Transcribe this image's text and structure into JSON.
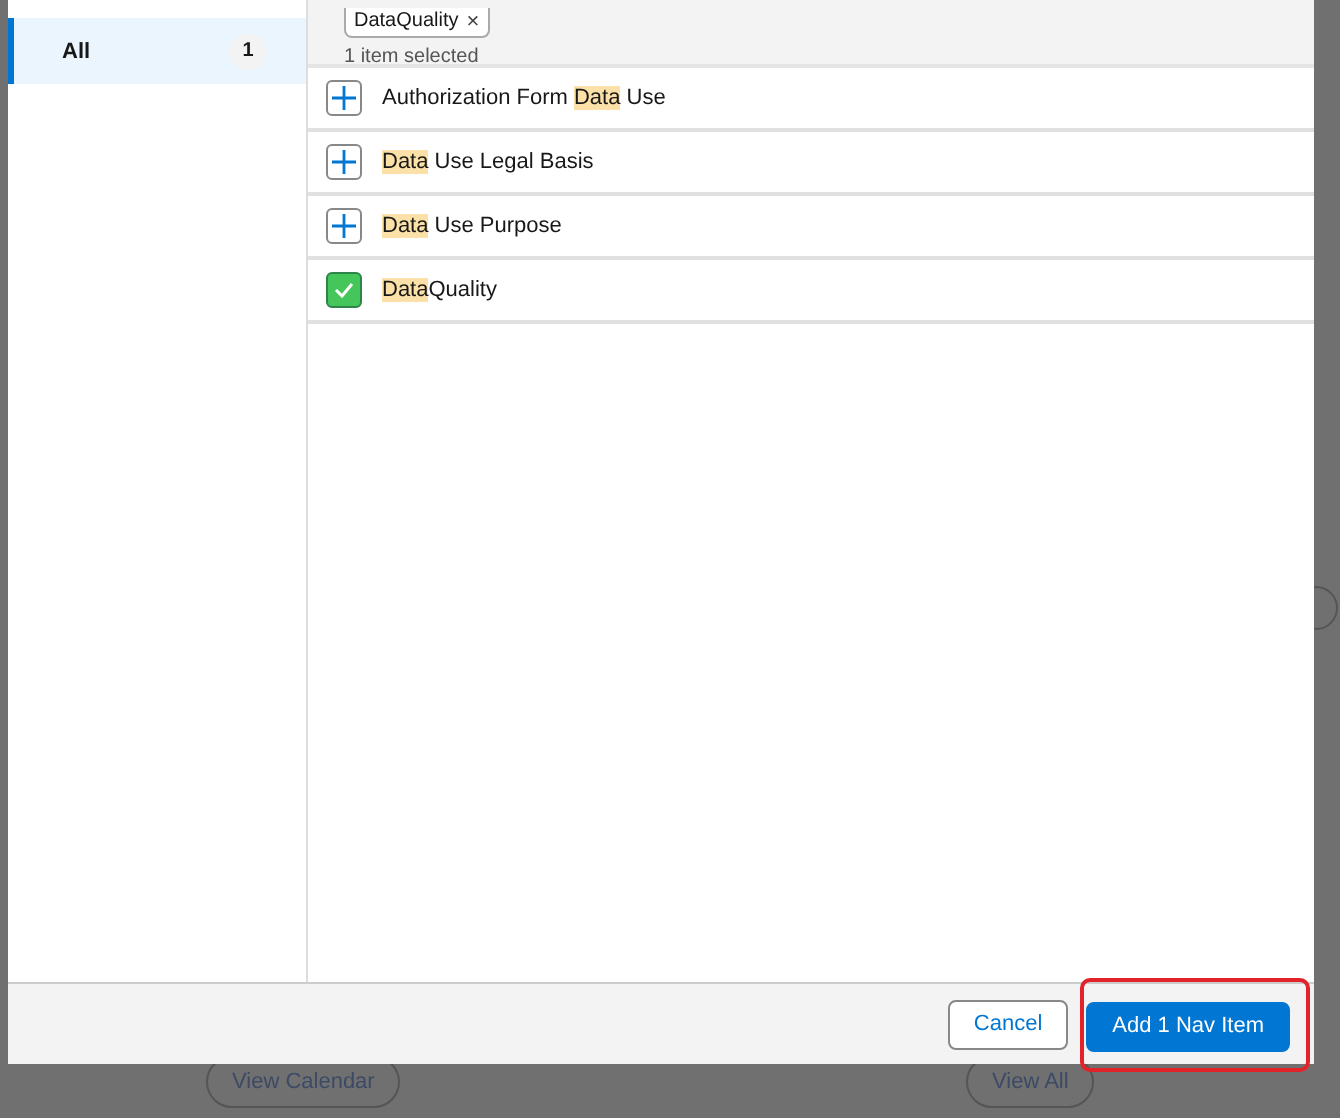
{
  "sidebar": {
    "items": [
      {
        "label": "All",
        "count": "1",
        "selected": true
      }
    ]
  },
  "selection": {
    "pills": [
      {
        "label": "DataQuality",
        "remove": "×"
      }
    ],
    "summary": "1 item selected"
  },
  "items": [
    {
      "parts": [
        {
          "text": "Authorization Form ",
          "match": false
        },
        {
          "text": "Data",
          "match": true
        },
        {
          "text": " Use",
          "match": false
        }
      ],
      "checked": false
    },
    {
      "parts": [
        {
          "text": "Data",
          "match": true
        },
        {
          "text": " Use Legal Basis",
          "match": false
        }
      ],
      "checked": false
    },
    {
      "parts": [
        {
          "text": "Data",
          "match": true
        },
        {
          "text": " Use Purpose",
          "match": false
        }
      ],
      "checked": false
    },
    {
      "parts": [
        {
          "text": "Data",
          "match": true
        },
        {
          "text": "Quality",
          "match": false
        }
      ],
      "checked": true
    }
  ],
  "footer": {
    "cancel": "Cancel",
    "confirm": "Add 1 Nav Item",
    "confirm_highlighted": true
  },
  "background": {
    "buttons": [
      "View Calendar",
      "View All"
    ]
  }
}
